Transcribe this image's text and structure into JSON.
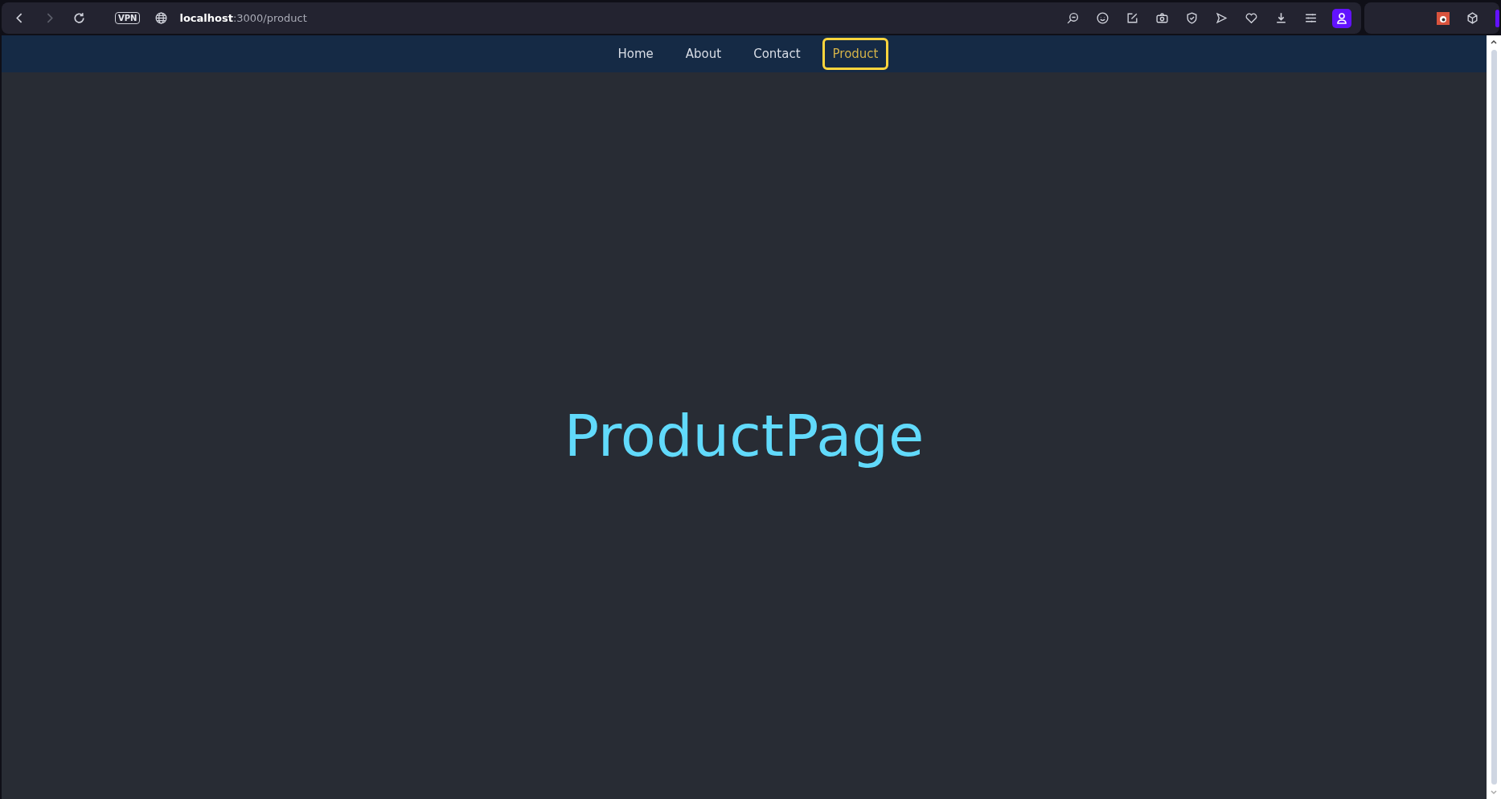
{
  "browser": {
    "vpn_badge": "VPN",
    "url_host": "localhost",
    "url_rest": ":3000/product"
  },
  "nav": {
    "items": [
      {
        "label": "Home",
        "selected": false
      },
      {
        "label": "About",
        "selected": false
      },
      {
        "label": "Contact",
        "selected": false
      },
      {
        "label": "Product",
        "selected": true
      }
    ]
  },
  "page": {
    "heading": "ProductPage"
  }
}
